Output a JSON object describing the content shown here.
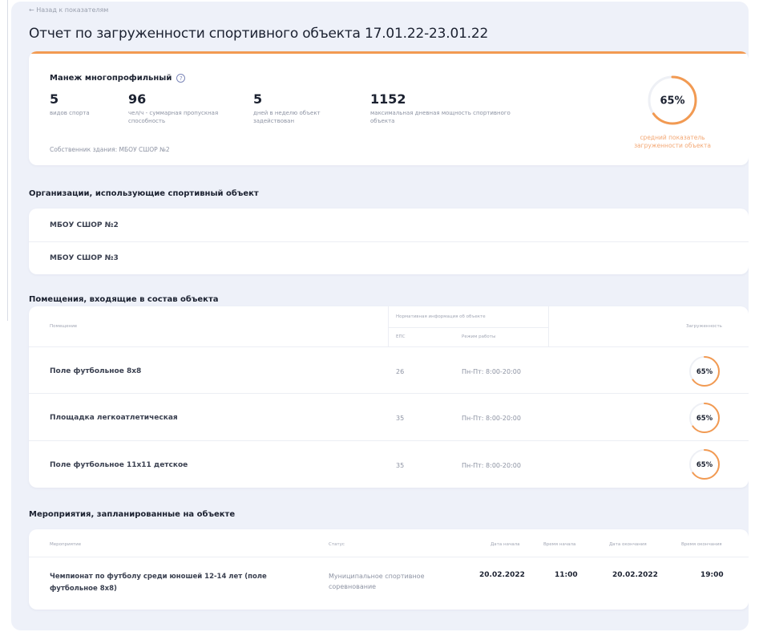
{
  "back_link": "← Назад к показателям",
  "page_title": "Отчет по загруженности спортивного объекта 17.01.22-23.01.22",
  "summary": {
    "object_name": "Манеж многопрофильный",
    "stats": [
      {
        "value": "5",
        "label": "видов спорта"
      },
      {
        "value": "96",
        "label": "чел/ч - суммарная пропускная способность"
      },
      {
        "value": "5",
        "label": "дней в неделю объект задействован"
      },
      {
        "value": "1152",
        "label": "максимальная дневная мощность спортивного объекта"
      }
    ],
    "owner": "Собственник здания: МБОУ СШОР №2",
    "load_label": "65%",
    "load_fraction": 0.65,
    "load_caption": "средний показатель загруженности объекта"
  },
  "organizations": {
    "title": "Организации, использующие спортивный объект",
    "items": [
      "МБОУ СШОР №2",
      "МБОУ СШОР №3"
    ]
  },
  "rooms": {
    "title": "Помещения, входящие в состав объекта",
    "headers": {
      "room": "Помещение",
      "normative": "Нормативная информация об объекте",
      "capacity": "ЕПС",
      "schedule": "Режим работы",
      "load": "Загруженность"
    },
    "rows": [
      {
        "name": "Поле футбольное 8х8",
        "capacity": "26",
        "schedule": "Пн-Пт: 8:00-20:00",
        "load_label": "65%",
        "load_fraction": 0.65
      },
      {
        "name": "Площадка легкоатлетическая",
        "capacity": "35",
        "schedule": "Пн-Пт: 8:00-20:00",
        "load_label": "65%",
        "load_fraction": 0.65
      },
      {
        "name": "Поле футбольное 11х11 детское",
        "capacity": "35",
        "schedule": "Пн-Пт: 8:00-20:00",
        "load_label": "65%",
        "load_fraction": 0.65
      }
    ]
  },
  "events": {
    "title": "Мероприятия, запланированные на объекте",
    "headers": {
      "event": "Мероприятие",
      "status": "Статус",
      "start_date": "Дата начала",
      "start_time": "Время начала",
      "end_date": "Дата окончания",
      "end_time": "Время окончания"
    },
    "rows": [
      {
        "title": "Чемпионат по футболу среди юношей 12-14 лет (поле футбольное 8х8)",
        "status": "Муниципальное спортивное соревнование",
        "start_date": "20.02.2022",
        "start_time": "11:00",
        "end_date": "20.02.2022",
        "end_time": "19:00"
      }
    ]
  },
  "colors": {
    "accent": "#f29a52",
    "gauge_track": "#eef0f5",
    "page_bg": "#eef1f9"
  }
}
